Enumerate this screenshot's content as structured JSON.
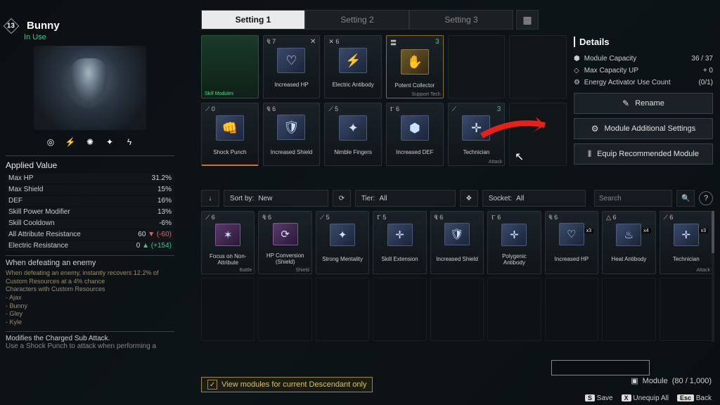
{
  "character": {
    "level": "13",
    "name": "Bunny",
    "status": "In Use"
  },
  "tabs": {
    "t1": "Setting 1",
    "t2": "Setting 2",
    "t3": "Setting 3"
  },
  "stats": {
    "header": "Applied Value",
    "rows": [
      {
        "k": "Max HP",
        "v": "31.2%"
      },
      {
        "k": "Max Shield",
        "v": "15%"
      },
      {
        "k": "DEF",
        "v": "16%"
      },
      {
        "k": "Skill Power Modifier",
        "v": "13%"
      },
      {
        "k": "Skill Cooldown",
        "v": "-6%"
      },
      {
        "k": "All Attribute Resistance",
        "v": "60",
        "d": "▼ (-60)",
        "neg": true
      },
      {
        "k": "Electric Resistance",
        "v": "0",
        "d": "▲ (+154)",
        "pos": true
      }
    ]
  },
  "when": {
    "header": "When defeating an enemy",
    "body": "When defeating an enemy, instantly recovers 12.2% of Custom Resources at a 4% chance",
    "body2": "Characters with Custom Resources",
    "chars": [
      "- Ajax",
      "- Bunny",
      "- Gley",
      "- Kyle"
    ]
  },
  "charged": {
    "l1": "Modifies the Charged Sub Attack.",
    "l2": "Use a Shock Punch to attack when performing a"
  },
  "equipped": {
    "skill_slot": "Skill Modules",
    "r1": [
      {
        "cost": "₠ 7",
        "sock": "✕",
        "icon": "♡",
        "label": "Increased HP"
      },
      {
        "cost": "✕ 6",
        "sock": "",
        "icon": "⚡",
        "label": "Electric Antibody"
      },
      {
        "cost": "〓",
        "sock": "3",
        "icon": "✋",
        "label": "Potent Collector",
        "sub": "Support Tech",
        "gold": true,
        "green": true
      }
    ],
    "r2": [
      {
        "cost": "⟋ 0",
        "sock": "",
        "icon": "👊",
        "label": "Shock Punch",
        "orange": true
      },
      {
        "cost": "₠ 6",
        "sock": "",
        "icon": "🛡",
        "label": "Increased Shield"
      },
      {
        "cost": "⟋ 5",
        "sock": "",
        "icon": "✦",
        "label": "Nimble Fingers"
      },
      {
        "cost": "Ⲅ 6",
        "sock": "",
        "icon": "⬢",
        "label": "Increased DEF"
      },
      {
        "cost": "⟋",
        "sock": "3",
        "icon": "✛",
        "label": "Technician",
        "sub": "Attack",
        "green": true
      }
    ]
  },
  "details": {
    "header": "Details",
    "cap": {
      "label": "Module Capacity",
      "val": "36 / 37"
    },
    "up": {
      "label": "Max Capacity UP",
      "val": "+ 0"
    },
    "act": {
      "label": "Energy Activator Use Count",
      "val": "(0/1)"
    }
  },
  "buttons": {
    "rename": "Rename",
    "mas": "Module Additional Settings",
    "erm": "Equip Recommended Module"
  },
  "filters": {
    "sort": {
      "label": "Sort by:",
      "val": "New"
    },
    "tier": {
      "label": "Tier:",
      "val": "All"
    },
    "socket": {
      "label": "Socket:",
      "val": "All"
    },
    "search": "Search"
  },
  "inventory": [
    {
      "cost": "⟋ 6",
      "icon": "✶",
      "label": "Focus on Non-Attribute",
      "sub": "Battle",
      "purple": true
    },
    {
      "cost": "₠ 6",
      "icon": "⟳",
      "label": "HP Conversion (Shield)",
      "sub": "Shield",
      "purple": true
    },
    {
      "cost": "⟋ 5",
      "icon": "✦",
      "label": "Strong Mentality"
    },
    {
      "cost": "Ⲅ 5",
      "icon": "✛",
      "label": "Skill Extension"
    },
    {
      "cost": "₠ 6",
      "icon": "🛡",
      "label": "Increased Shield"
    },
    {
      "cost": "Ⲅ 6",
      "icon": "✛",
      "label": "Polygenic Antibody"
    },
    {
      "cost": "₠ 6",
      "icon": "♡",
      "label": "Increased HP",
      "count": "x3"
    },
    {
      "cost": "△ 6",
      "icon": "♨",
      "label": "Heat Antibody",
      "count": "x4"
    },
    {
      "cost": "⟋ 6",
      "icon": "✛",
      "label": "Technician",
      "sub": "Attack",
      "count": "x3"
    }
  ],
  "bottom": {
    "check": "View modules for current Descendant only",
    "module": {
      "label": "Module",
      "val": "(80 / 1,000)"
    },
    "save": "Save",
    "unequip": "Unequip All",
    "back": "Back",
    "key_s": "S",
    "key_x": "X",
    "key_esc": "Esc"
  }
}
